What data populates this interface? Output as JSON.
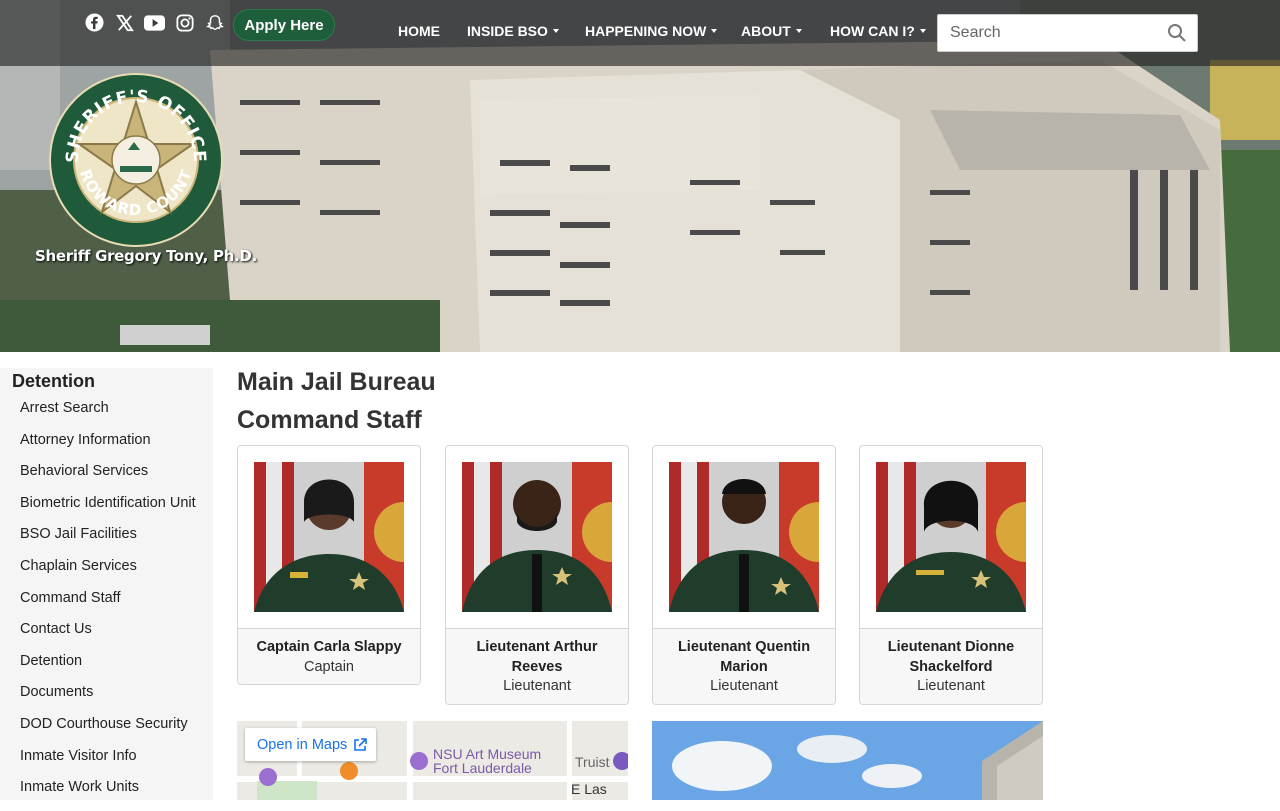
{
  "header": {
    "social": [
      {
        "name": "facebook-icon"
      },
      {
        "name": "x-icon"
      },
      {
        "name": "youtube-icon"
      },
      {
        "name": "instagram-icon"
      },
      {
        "name": "snapchat-icon"
      }
    ],
    "apply_label": "Apply Here",
    "nav": [
      {
        "label": "HOME",
        "dropdown": false
      },
      {
        "label": "INSIDE BSO",
        "dropdown": true
      },
      {
        "label": "HAPPENING NOW",
        "dropdown": true
      },
      {
        "label": "ABOUT",
        "dropdown": true
      },
      {
        "label": "HOW CAN I?",
        "dropdown": true
      }
    ],
    "search_placeholder": "Search"
  },
  "logo": {
    "badge_text_top": "SHERIFF'S OFFICE",
    "badge_text_bottom": "BROWARD COUNTY",
    "sheriff_name": "Sheriff Gregory Tony, Ph.D."
  },
  "sidebar": {
    "heading": "Detention",
    "items": [
      "Arrest Search",
      "Attorney Information",
      "Behavioral Services",
      "Biometric Identification Unit",
      "BSO Jail Facilities",
      "Chaplain Services",
      "Command Staff",
      "Contact Us",
      "Detention",
      "Documents",
      "DOD Courthouse Security",
      "Inmate Visitor Info",
      "Inmate Work Units"
    ]
  },
  "main": {
    "title": "Main Jail Bureau",
    "subtitle": "Command Staff",
    "staff": [
      {
        "name": "Captain Carla Slappy",
        "rank": "Captain"
      },
      {
        "name": "Lieutenant Arthur Reeves",
        "rank": "Lieutenant"
      },
      {
        "name": "Lieutenant Quentin Marion",
        "rank": "Lieutenant"
      },
      {
        "name": "Lieutenant Dionne Shackelford",
        "rank": "Lieutenant"
      }
    ],
    "map": {
      "open_label": "Open in Maps",
      "labels": [
        "NSU Art Museum",
        "Fort Lauderdale",
        "Truist",
        "E Las Olas"
      ]
    }
  },
  "colors": {
    "apply_green": "#1e5e3a",
    "badge_green": "#1f5a3a",
    "uniform_green": "#1f3d2a",
    "map_link": "#1a73e8"
  }
}
